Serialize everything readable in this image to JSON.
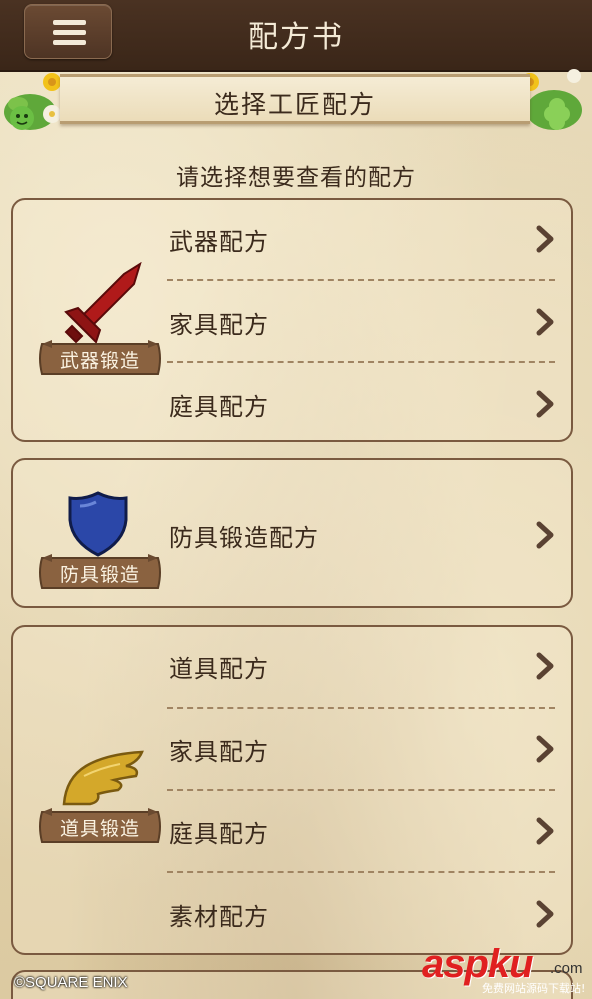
{
  "header": {
    "title": "配方书",
    "menu_icon": "hamburger-menu-icon"
  },
  "banner": {
    "title": "选择工匠配方"
  },
  "subtitle": "请选择想要查看的配方",
  "sections": [
    {
      "label": "武器锻造",
      "icon": "sword-icon",
      "items": [
        "武器配方",
        "家具配方",
        "庭具配方"
      ]
    },
    {
      "label": "防具锻造",
      "icon": "shield-icon",
      "items": [
        "防具锻造配方"
      ]
    },
    {
      "label": "道具锻造",
      "icon": "wing-icon",
      "items": [
        "道具配方",
        "家具配方",
        "庭具配方",
        "素材配方"
      ]
    }
  ],
  "footer": {
    "copyright": "©SQUARE ENIX"
  },
  "watermark": {
    "main": "aspku",
    "domain": ".com",
    "sub": "免费网站源码下载站!"
  },
  "colors": {
    "topbar": "#3a2618",
    "panel_border": "#7a5a40",
    "text": "#3b2a1c",
    "scroll": "#8a6240",
    "sword": "#b01a1a",
    "shield": "#2b47a8",
    "wing": "#d4a82a"
  }
}
